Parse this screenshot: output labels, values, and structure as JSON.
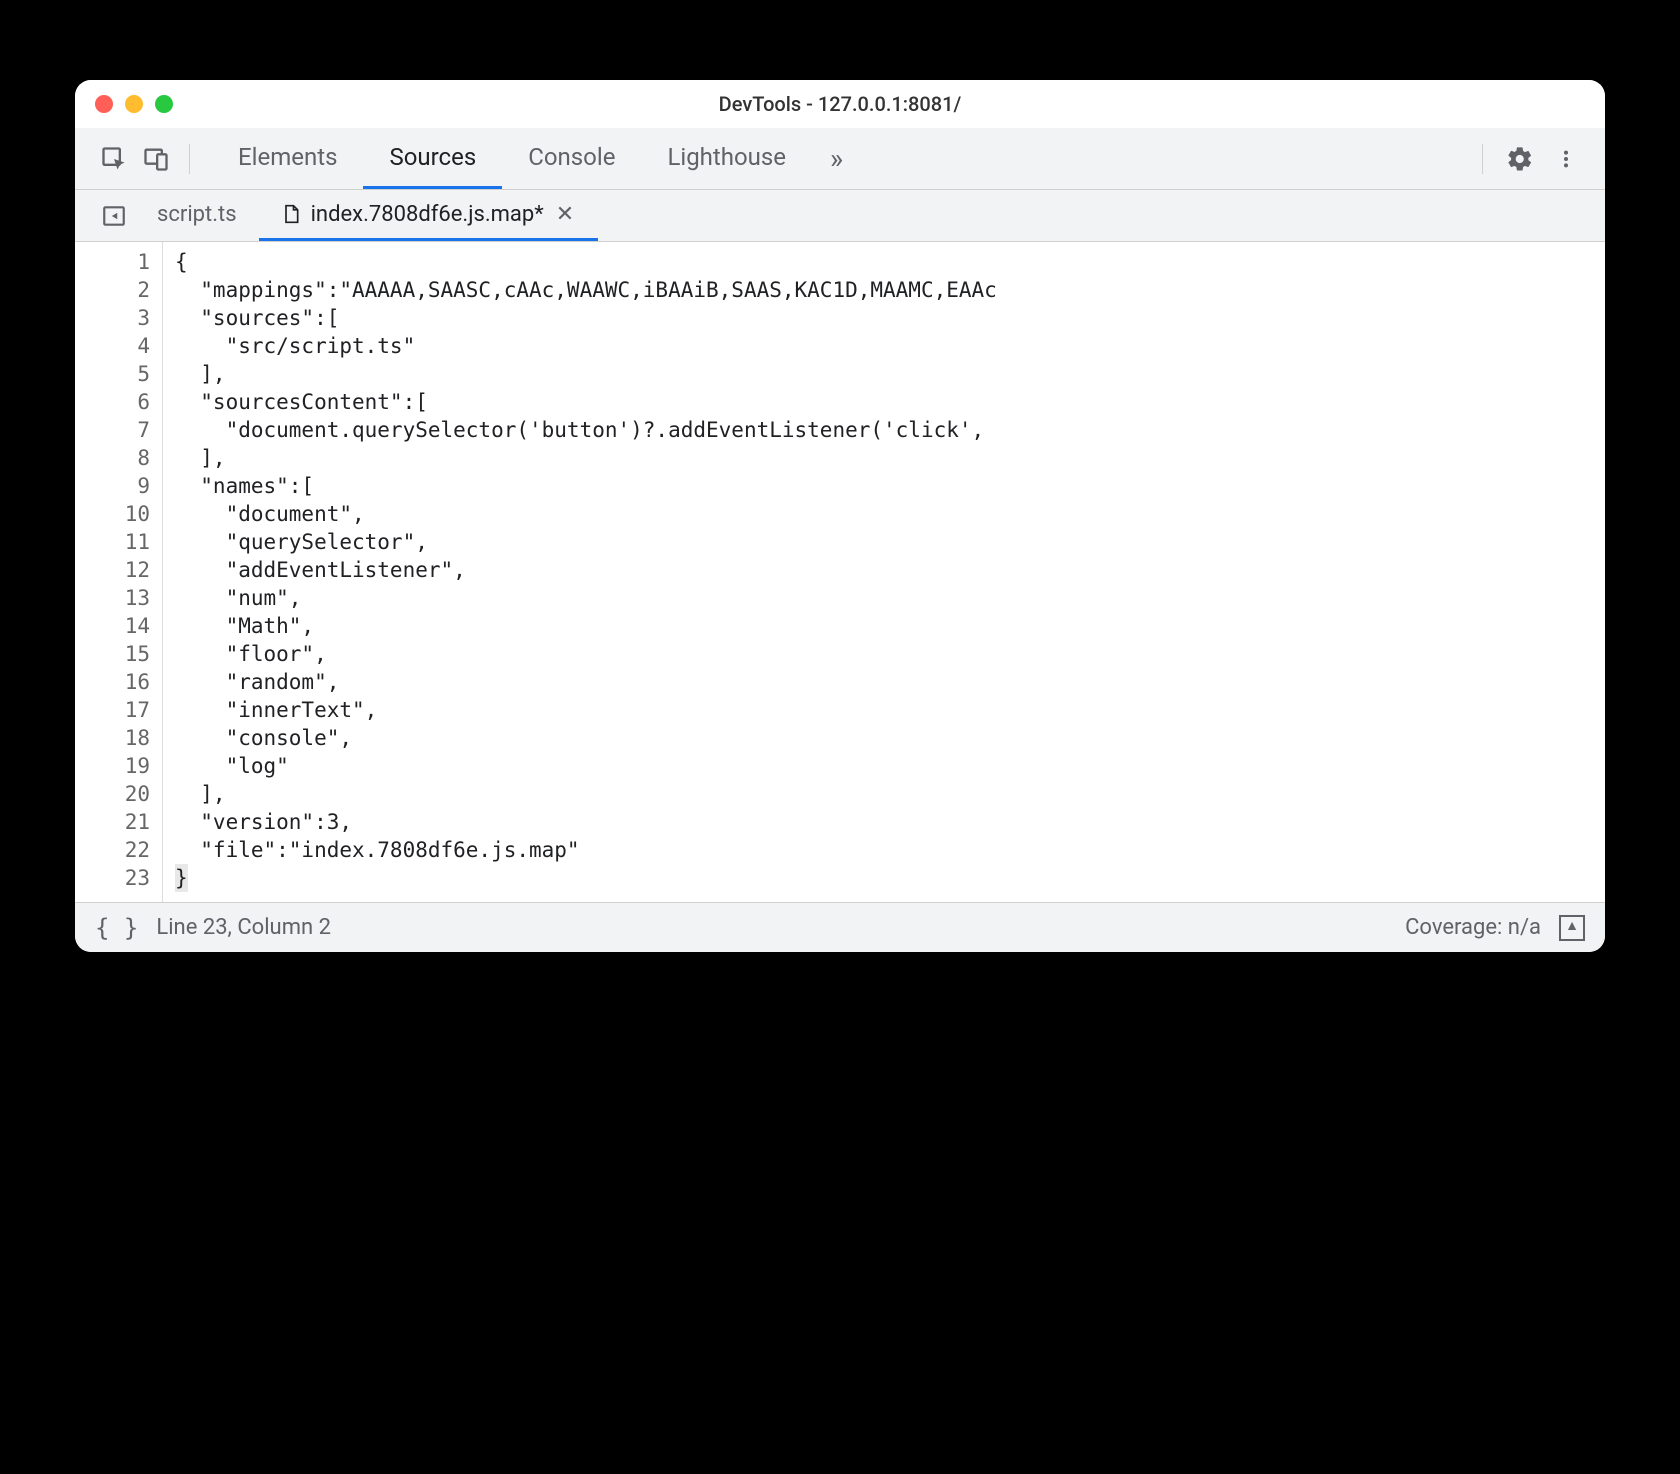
{
  "window": {
    "title": "DevTools - 127.0.0.1:8081/"
  },
  "main_tabs": [
    {
      "label": "Elements",
      "active": false
    },
    {
      "label": "Sources",
      "active": true
    },
    {
      "label": "Console",
      "active": false
    },
    {
      "label": "Lighthouse",
      "active": false
    }
  ],
  "overflow_indicator": "»",
  "file_tabs": [
    {
      "label": "script.ts",
      "active": false,
      "has_icon": false,
      "modified": false
    },
    {
      "label": "index.7808df6e.js.map*",
      "active": true,
      "has_icon": true,
      "modified": true
    }
  ],
  "code_lines": [
    "{",
    "  \"mappings\":\"AAAAA,SAASC,cAAc,WAAWC,iBAAiB,SAAS,KAC1D,MAAMC,EAAc",
    "  \"sources\":[",
    "    \"src/script.ts\"",
    "  ],",
    "  \"sourcesContent\":[",
    "    \"document.querySelector('button')?.addEventListener('click',",
    "  ],",
    "  \"names\":[",
    "    \"document\",",
    "    \"querySelector\",",
    "    \"addEventListener\",",
    "    \"num\",",
    "    \"Math\",",
    "    \"floor\",",
    "    \"random\",",
    "    \"innerText\",",
    "    \"console\",",
    "    \"log\"",
    "  ],",
    "  \"version\":3,",
    "  \"file\":\"index.7808df6e.js.map\"",
    "}"
  ],
  "statusbar": {
    "format_icon": "{ }",
    "cursor": "Line 23, Column 2",
    "coverage": "Coverage: n/a"
  }
}
